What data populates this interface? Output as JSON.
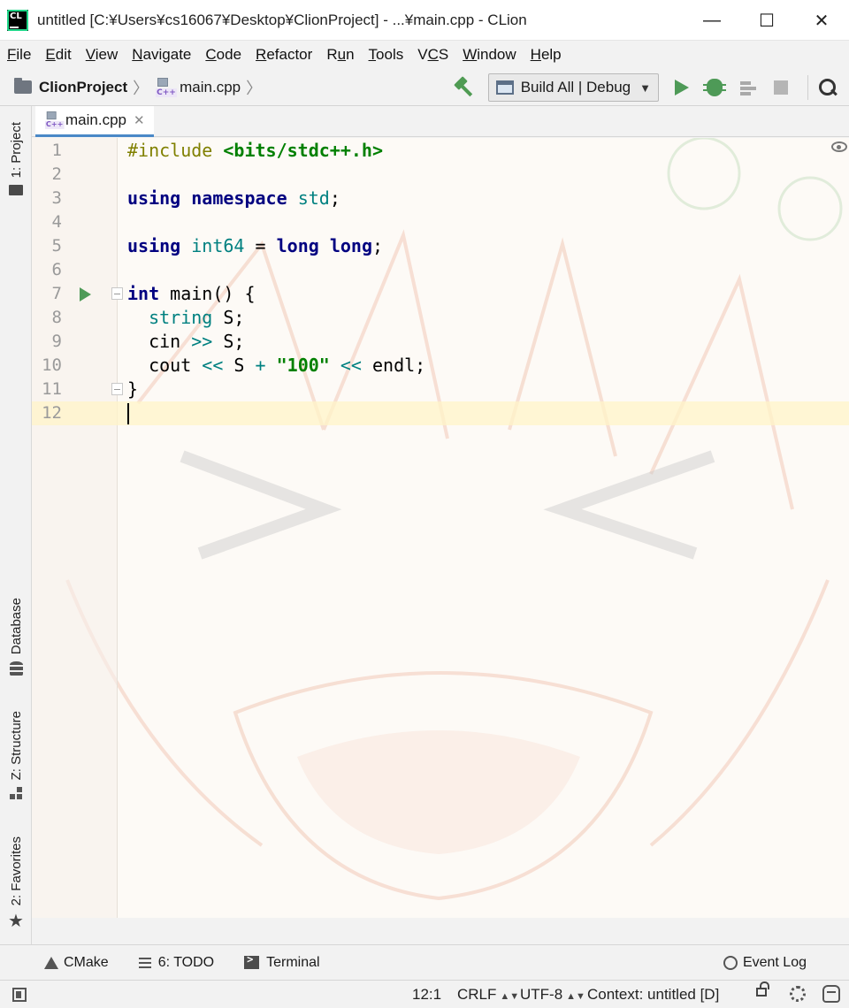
{
  "window": {
    "logo_text": "CL",
    "title": "untitled [C:¥Users¥cs16067¥Desktop¥ClionProject] - ...¥main.cpp - CLion",
    "minimize": "—",
    "maximize": "☐",
    "close": "✕"
  },
  "menu": [
    {
      "label": "File",
      "mnemonic_index": 0
    },
    {
      "label": "Edit",
      "mnemonic_index": 0
    },
    {
      "label": "View",
      "mnemonic_index": 0
    },
    {
      "label": "Navigate",
      "mnemonic_index": 0
    },
    {
      "label": "Code",
      "mnemonic_index": 0
    },
    {
      "label": "Refactor",
      "mnemonic_index": 0
    },
    {
      "label": "Run",
      "mnemonic_index": 1
    },
    {
      "label": "Tools",
      "mnemonic_index": 0
    },
    {
      "label": "VCS",
      "mnemonic_index": 1
    },
    {
      "label": "Window",
      "mnemonic_index": 0
    },
    {
      "label": "Help",
      "mnemonic_index": 0
    }
  ],
  "navbar": {
    "project": "ClionProject",
    "file": "main.cpp",
    "run_config": "Build All | Debug",
    "file_icon_label": "C++"
  },
  "left_tools": {
    "project": "1: Project",
    "database": "Database",
    "structure": "Z: Structure",
    "favorites": "2: Favorites"
  },
  "editor": {
    "tab_label": "main.cpp",
    "tab_close": "✕",
    "current_line": 12,
    "lines": [
      "#include <bits/stdc++.h>",
      "",
      "using namespace std;",
      "",
      "using int64 = long long;",
      "",
      "int main() {",
      "  string S;",
      "  cin >> S;",
      "  cout << S + \"100\" << endl;",
      "}",
      ""
    ]
  },
  "bottom_tools": {
    "cmake": "CMake",
    "todo": "6: TODO",
    "terminal": "Terminal",
    "event_log": "Event Log"
  },
  "status": {
    "position": "12:1",
    "line_sep": "CRLF",
    "encoding": "UTF-8",
    "context": "Context: untitled [D]"
  },
  "colors": {
    "keyword": "#000080",
    "string": "#008000",
    "preprocessor": "#808000",
    "type": "#008080",
    "run_green": "#4e9a57",
    "current_line": "#fff4c8"
  }
}
